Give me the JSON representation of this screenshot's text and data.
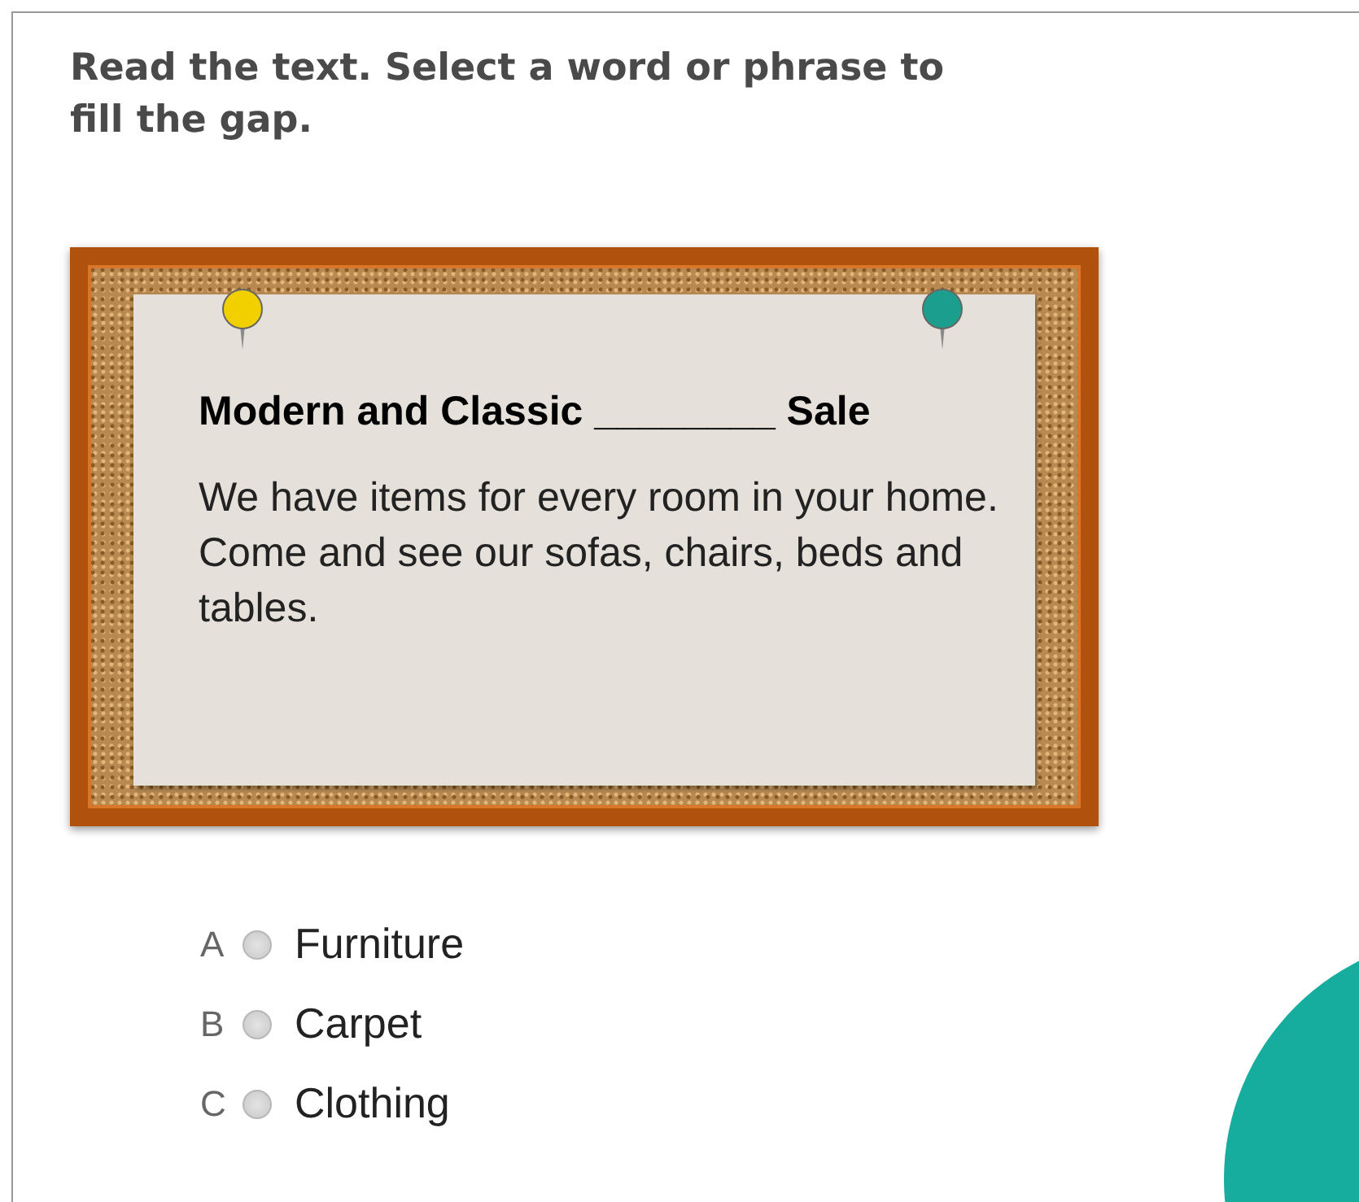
{
  "instruction": "Read the text. Select a word or phrase to fill the gap.",
  "notice": {
    "heading": "Modern and Classic ________ Sale",
    "body": "We have items for every room in your home. Come and see our sofas, chairs, beds and tables."
  },
  "options": [
    {
      "letter": "A",
      "label": "Furniture",
      "selected": false
    },
    {
      "letter": "B",
      "label": "Carpet",
      "selected": false
    },
    {
      "letter": "C",
      "label": "Clothing",
      "selected": false
    }
  ]
}
